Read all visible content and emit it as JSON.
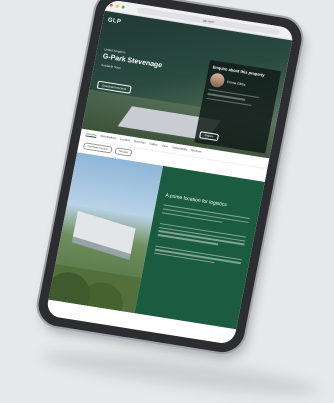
{
  "browser": {
    "url": "glp.com"
  },
  "site": {
    "logo": "GLP",
    "nav": [
      "",
      "",
      "",
      "",
      ""
    ]
  },
  "hero": {
    "breadcrumb": "United Kingdom",
    "title": "G-Park Stevenage",
    "subtitle": "Available Soon",
    "cta": "Download brochure"
  },
  "contact": {
    "heading": "Enquire about this property",
    "name": "Emma Gibbs",
    "button": "Enquire"
  },
  "tabs": [
    "Overview",
    "Specifications",
    "Location",
    "Floor Plan",
    "Gallery",
    "Video",
    "Sustainability",
    "Brochure"
  ],
  "chips": [
    "Download brochure",
    "Site plan"
  ],
  "feature": {
    "heading": "A prime location for logistics"
  },
  "colors": {
    "brand_green": "#1b5b3f",
    "hero_dark": "#1f3a33"
  }
}
